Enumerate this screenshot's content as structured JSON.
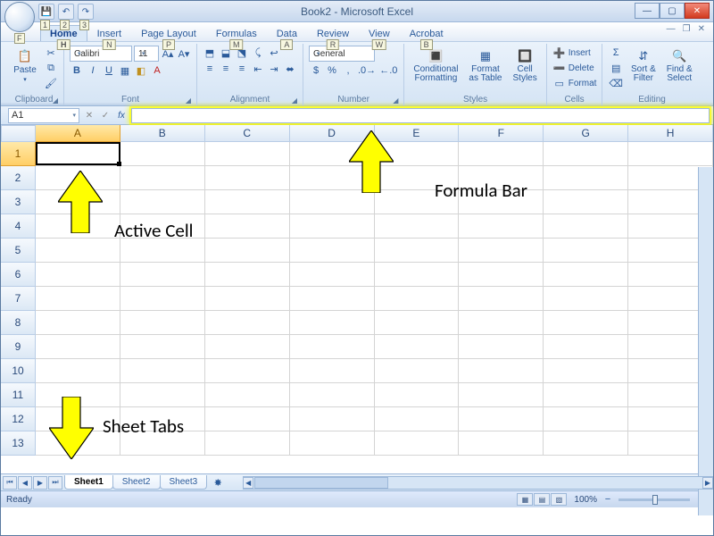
{
  "title": "Book2 - Microsoft Excel",
  "qat_tips": [
    "1",
    "2",
    "3"
  ],
  "tabs": [
    {
      "label": "Home",
      "key": "H",
      "active": true
    },
    {
      "label": "Insert",
      "key": "N",
      "active": false
    },
    {
      "label": "Page Layout",
      "key": "P",
      "active": false
    },
    {
      "label": "Formulas",
      "key": "M",
      "active": false
    },
    {
      "label": "Data",
      "key": "A",
      "active": false
    },
    {
      "label": "Review",
      "key": "R",
      "active": false
    },
    {
      "label": "View",
      "key": "W",
      "active": false
    },
    {
      "label": "Acrobat",
      "key": "B",
      "active": false
    }
  ],
  "ribbon": {
    "clipboard": {
      "label": "Clipboard",
      "paste": "Paste"
    },
    "font": {
      "label": "Font",
      "name": "Calibri",
      "size": "11"
    },
    "alignment": {
      "label": "Alignment"
    },
    "number": {
      "label": "Number",
      "format": "General"
    },
    "styles": {
      "label": "Styles",
      "cond": "Conditional\nFormatting",
      "table": "Format\nas Table",
      "cell": "Cell\nStyles"
    },
    "cells": {
      "label": "Cells",
      "insert": "Insert",
      "delete": "Delete",
      "format": "Format"
    },
    "editing": {
      "label": "Editing",
      "sort": "Sort &\nFilter",
      "find": "Find &\nSelect"
    }
  },
  "name_box": "A1",
  "fx_symbol": "fx",
  "columns": [
    "A",
    "B",
    "C",
    "D",
    "E",
    "F",
    "G",
    "H"
  ],
  "rows": [
    "1",
    "2",
    "3",
    "4",
    "5",
    "6",
    "7",
    "8",
    "9",
    "10",
    "11",
    "12",
    "13"
  ],
  "active_col": "A",
  "active_row": "1",
  "sheets": [
    {
      "label": "Sheet1",
      "active": true
    },
    {
      "label": "Sheet2",
      "active": false
    },
    {
      "label": "Sheet3",
      "active": false
    }
  ],
  "status": "Ready",
  "zoom": "100%",
  "annotations": {
    "formula_bar": "Formula Bar",
    "active_cell": "Active Cell",
    "sheet_tabs": "Sheet Tabs"
  }
}
